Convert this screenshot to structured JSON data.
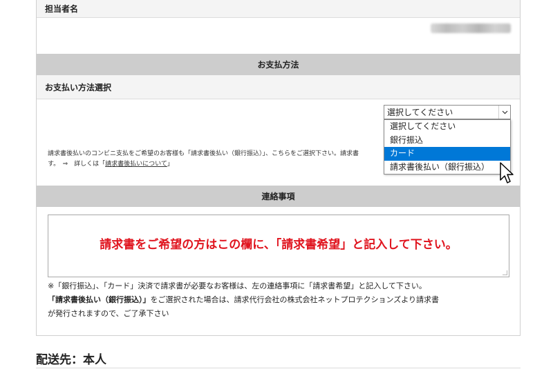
{
  "contact_person": {
    "label": "担当者名"
  },
  "payment_section": {
    "title": "お支払方法",
    "method_label": "お支払い方法選択"
  },
  "payment_select": {
    "current": "選択してください",
    "options": [
      "選択してください",
      "銀行振込",
      "カード",
      "請求書後払い（銀行振込）"
    ],
    "highlighted_index": 2
  },
  "payment_note": {
    "line1": "請求書後払いのコンビニ支払をご希望のお客様も「請求書後払い（銀行振込）」、こちらをご選択下さい。請求書",
    "line2_prefix": "す。　⇒　詳しくは「",
    "line2_link": "請求書後払いについて",
    "line2_suffix": "」"
  },
  "contact_section": {
    "title": "連絡事項",
    "textarea_text": "請求書をご希望の方はこの欄に、「請求書希望」と記入して下さい。"
  },
  "footer_notes": {
    "line1": "※「銀行振込」、「カード」決済で請求書が必要なお客様は、左の連絡事項に「請求書希望」と記入して下さい。",
    "line2_bold": "「請求書後払い（銀行振込）」",
    "line2_rest": "をご選択された場合は、請求代行会社の株式会社ネットプロテクションズより請求書",
    "line3": "が発行されますので、ご了承下さい"
  },
  "delivery": {
    "heading": "配送先：本人"
  },
  "colors": {
    "highlight": "#0078d7",
    "notice_red": "#e0141e",
    "section_grey": "#cdcdcd"
  }
}
